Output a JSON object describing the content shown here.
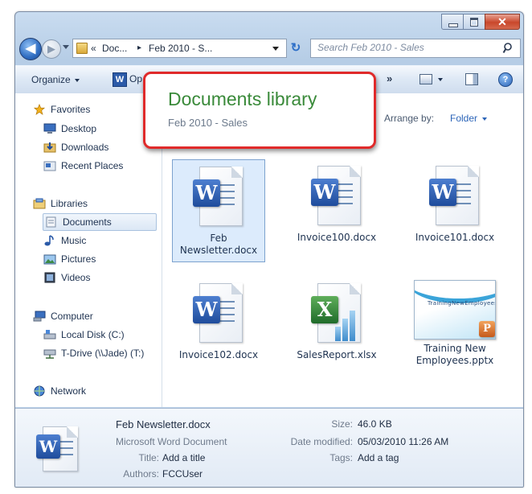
{
  "window": {
    "close_glyph": "✕"
  },
  "nav": {
    "back_glyph": "◀",
    "forward_glyph": "▶",
    "breadcrumb": [
      "«",
      "Doc...",
      "▸",
      "Feb 2010 - S..."
    ],
    "refresh_glyph": "↻",
    "search_placeholder": "Search Feb 2010 - Sales"
  },
  "toolbar": {
    "organize_label": "Organize",
    "open_label": "Op",
    "open_icon_letter": "W",
    "more_glyph": "»",
    "help_glyph": "?"
  },
  "sidebar": {
    "favorites": {
      "label": "Favorites",
      "icon": "star-icon"
    },
    "favorites_items": [
      {
        "label": "Desktop",
        "icon": "desktop-icon"
      },
      {
        "label": "Downloads",
        "icon": "downloads-icon"
      },
      {
        "label": "Recent Places",
        "icon": "recent-places-icon"
      }
    ],
    "libraries": {
      "label": "Libraries",
      "icon": "libraries-icon"
    },
    "libraries_items": [
      {
        "label": "Documents",
        "icon": "documents-icon",
        "selected": true
      },
      {
        "label": "Music",
        "icon": "music-icon"
      },
      {
        "label": "Pictures",
        "icon": "pictures-icon"
      },
      {
        "label": "Videos",
        "icon": "videos-icon"
      }
    ],
    "computer": {
      "label": "Computer",
      "icon": "computer-icon"
    },
    "computer_items": [
      {
        "label": "Local Disk (C:)",
        "icon": "local-disk-icon"
      },
      {
        "label": "T-Drive (\\\\Jade) (T:)",
        "icon": "network-drive-icon"
      }
    ],
    "network": {
      "label": "Network",
      "icon": "network-icon"
    }
  },
  "library_header": {
    "title": "Documents library",
    "subtitle": "Feb 2010 - Sales"
  },
  "arrange": {
    "label": "Arrange by:",
    "value": "Folder"
  },
  "files": [
    {
      "name_line1": "Feb",
      "name_line2": "Newsletter.docx",
      "type": "word",
      "letter": "W",
      "selected": true
    },
    {
      "name_line1": "Invoice100.docx",
      "name_line2": "",
      "type": "word",
      "letter": "W"
    },
    {
      "name_line1": "Invoice101.docx",
      "name_line2": "",
      "type": "word",
      "letter": "W"
    },
    {
      "name_line1": "Invoice102.docx",
      "name_line2": "",
      "type": "word",
      "letter": "W"
    },
    {
      "name_line1": "SalesReport.xlsx",
      "name_line2": "",
      "type": "excel",
      "letter": "X"
    },
    {
      "name_line1": "Training New",
      "name_line2": "Employees.pptx",
      "type": "ppt",
      "letter": "P",
      "thumb_title": "TrainingNewEmployees"
    }
  ],
  "details": {
    "file_name": "Feb Newsletter.docx",
    "file_type": "Microsoft Word Document",
    "icon_letter": "W",
    "title_label": "Title:",
    "title_value": "Add a title",
    "authors_label": "Authors:",
    "authors_value": "FCCUser",
    "size_label": "Size:",
    "size_value": "46.0 KB",
    "modified_label": "Date modified:",
    "modified_value": "05/03/2010 11:26 AM",
    "tags_label": "Tags:",
    "tags_value": "Add a tag"
  },
  "colors": {
    "callout_border": "#e02a2a",
    "callout_title": "#3a8a3a",
    "link_blue": "#2b64b8",
    "selection_fill": "#dcebfc"
  }
}
